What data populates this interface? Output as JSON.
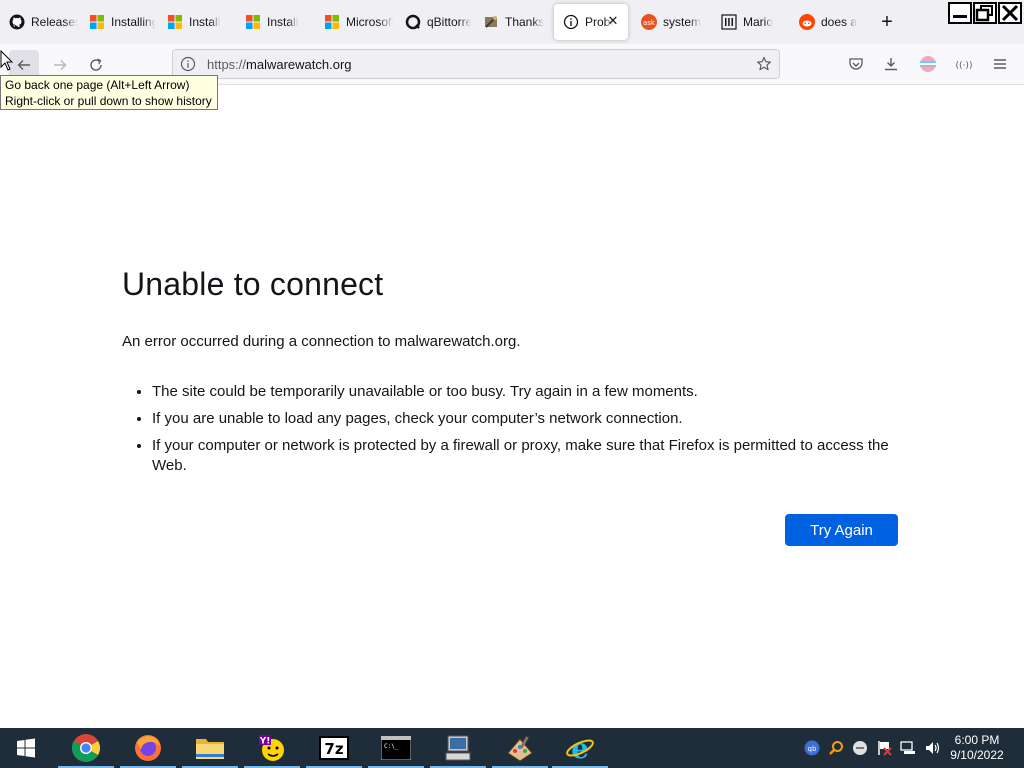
{
  "tabs": [
    {
      "label": "Releases",
      "icon": "github-icon"
    },
    {
      "label": "Installing",
      "icon": "microsoft-icon"
    },
    {
      "label": "Install",
      "icon": "microsoft-icon"
    },
    {
      "label": "Install",
      "icon": "microsoft-icon"
    },
    {
      "label": "Microsoft",
      "icon": "microsoft-icon"
    },
    {
      "label": "qBittorrent",
      "icon": "qbittorrent-icon"
    },
    {
      "label": "Thanks",
      "icon": "wrench-icon"
    },
    {
      "label": "Problem",
      "icon": "info-icon",
      "active": true
    },
    {
      "label": "system",
      "icon": "ask-icon"
    },
    {
      "label": "Mario",
      "icon": "museum-icon"
    },
    {
      "label": "does a",
      "icon": "reddit-icon"
    }
  ],
  "nav": {
    "url_proto": "https://",
    "url_host": "malwarewatch.org"
  },
  "tooltip": {
    "line1": "Go back one page (Alt+Left Arrow)",
    "line2": "Right-click or pull down to show history"
  },
  "error": {
    "title": "Unable to connect",
    "description": "An error occurred during a connection to malwarewatch.org.",
    "items": [
      "The site could be temporarily unavailable or too busy. Try again in a few moments.",
      "If you are unable to load any pages, check your computer’s network connection.",
      "If your computer or network is protected by a firewall or proxy, make sure that Firefox is permitted to access the Web."
    ],
    "button": "Try Again"
  },
  "taskbar": {
    "apps": [
      "chrome-icon",
      "firefox-icon",
      "file-explorer-icon",
      "yahoo-messenger-icon",
      "7zip-icon",
      "command-prompt-icon",
      "network-computer-icon",
      "paint-icon",
      "internet-explorer-icon"
    ],
    "time": "6:00 PM",
    "date": "9/10/2022"
  },
  "colors": {
    "accent": "#0061e0",
    "taskbar": "#1f2d3b",
    "tooltip_bg": "#ffffe1"
  }
}
